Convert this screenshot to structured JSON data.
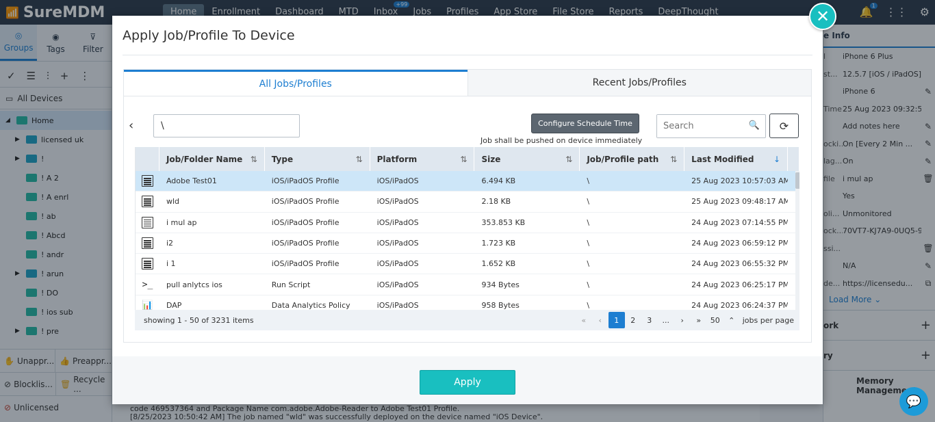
{
  "app": {
    "logo_text": "SureMDM",
    "nav": [
      {
        "label": "Home"
      },
      {
        "label": "Enrollment"
      },
      {
        "label": "Dashboard"
      },
      {
        "label": "MTD"
      },
      {
        "label": "Inbox",
        "badge": "+99"
      },
      {
        "label": "Jobs"
      },
      {
        "label": "Profiles"
      },
      {
        "label": "App Store"
      },
      {
        "label": "File Store"
      },
      {
        "label": "Reports"
      },
      {
        "label": "DeepThought"
      }
    ],
    "bell_badge": "1"
  },
  "left_panel": {
    "tabs": [
      {
        "label": "Groups"
      },
      {
        "label": "Tags"
      },
      {
        "label": "Filter"
      }
    ],
    "all_devices": "All Devices",
    "tree": [
      {
        "label": "Home",
        "expanded": true
      },
      {
        "label": "licensed uk",
        "arrow": true
      },
      {
        "label": "!",
        "arrow": true
      },
      {
        "label": "! A 2"
      },
      {
        "label": "! A enrl"
      },
      {
        "label": "! ab"
      },
      {
        "label": "! Abcd"
      },
      {
        "label": "! andr"
      },
      {
        "label": "! arun",
        "arrow": true
      },
      {
        "label": "! DO"
      },
      {
        "label": "! ios sub"
      },
      {
        "label": "! pre",
        "arrow": true
      }
    ],
    "bottom": [
      [
        "Unappr...",
        "Preappr..."
      ],
      [
        "Blocklis...",
        "Recycle ..."
      ],
      [
        "Unlicensed"
      ]
    ]
  },
  "right_panel": {
    "header": "e Info",
    "rows": [
      {
        "k": "l",
        "v": "iPhone 6 Plus"
      },
      {
        "k": "st...",
        "v": "12.5.7 [iOS / iPadOS]"
      },
      {
        "k": "",
        "v": "iPhone 6",
        "action": "edit"
      },
      {
        "k": "Time",
        "v": "25 Aug 2023 09:32:50 A..."
      },
      {
        "k": "",
        "v": "Add notes here",
        "action": "edit"
      },
      {
        "k": "ocki...",
        "v": "On [Every 2 Min ...",
        "action": "edit"
      },
      {
        "k": "lag...",
        "v": "On",
        "action": "edit"
      },
      {
        "k": "file",
        "v": "i mul ap",
        "action": "delete"
      },
      {
        "k": "",
        "v": "Yes"
      },
      {
        "k": "oli...",
        "v": "Unmonitored"
      },
      {
        "k": "ock...",
        "v": "70VT7-KJ7A9-0UQ5-9X..."
      },
      {
        "k": "ssi...",
        "v": "",
        "action": "delete"
      },
      {
        "k": "",
        "v": "N/A",
        "action": "edit"
      },
      {
        "k": "de...",
        "v": "https://licensedu...",
        "action": "copy"
      }
    ],
    "load_more": "Load More",
    "sections": [
      "ork",
      "ry",
      "Memory Management"
    ]
  },
  "log": {
    "line1": "code 469537364 and Package Name com.adobe.Adobe-Reader to Adobe Test01 Profile.",
    "line2": "[8/25/2023 10:50:42 AM] The job named \"wld\" was successfully deployed on the device named \"iOS Device\"."
  },
  "modal": {
    "title": "Apply Job/Profile To Device",
    "tabs": [
      {
        "label": "All Jobs/Profiles",
        "active": true
      },
      {
        "label": "Recent Jobs/Profiles",
        "active": false
      }
    ],
    "path_value": "\\",
    "schedule_button": "Configure Schedule Time",
    "schedule_note": "Job shall be pushed on device immediately",
    "search_placeholder": "Search",
    "columns": [
      "Job/Folder Name",
      "Type",
      "Platform",
      "Size",
      "Job/Profile path",
      "Last Modified"
    ],
    "rows": [
      {
        "icon": "profile-icon",
        "name": "Adobe Test01",
        "type": "iOS/iPadOS Profile",
        "platform": "iOS/iPadOS",
        "size": "6.494 KB",
        "path": "\\",
        "modified": "25 Aug 2023 10:57:03 AM",
        "selected": true
      },
      {
        "icon": "profile-icon",
        "name": "wld",
        "type": "iOS/iPadOS Profile",
        "platform": "iOS/iPadOS",
        "size": "2.18 KB",
        "path": "\\",
        "modified": "25 Aug 2023 09:48:17 AM"
      },
      {
        "icon": "profile-icon",
        "name": "i mul ap",
        "type": "iOS/iPadOS Profile",
        "platform": "iOS/iPadOS",
        "size": "353.853 KB",
        "path": "\\",
        "modified": "24 Aug 2023 07:14:55 PM"
      },
      {
        "icon": "profile-icon",
        "name": "i2",
        "type": "iOS/iPadOS Profile",
        "platform": "iOS/iPadOS",
        "size": "1.723 KB",
        "path": "\\",
        "modified": "24 Aug 2023 06:59:12 PM"
      },
      {
        "icon": "profile-icon",
        "name": "i 1",
        "type": "iOS/iPadOS Profile",
        "platform": "iOS/iPadOS",
        "size": "1.652 KB",
        "path": "\\",
        "modified": "24 Aug 2023 06:55:32 PM"
      },
      {
        "icon": "script-icon",
        "name": "pull anlytcs ios",
        "type": "Run Script",
        "platform": "iOS/iPadOS",
        "size": "934 Bytes",
        "path": "\\",
        "modified": "24 Aug 2023 06:25:17 PM"
      },
      {
        "icon": "analytics-icon",
        "name": "DAP",
        "type": "Data Analytics Policy",
        "platform": "iOS/iPadOS",
        "size": "958 Bytes",
        "path": "\\",
        "modified": "24 Aug 2023 06:24:37 PM"
      }
    ],
    "showing": "showing 1 - 50 of 3231 items",
    "pages": [
      "1",
      "2",
      "3",
      "..."
    ],
    "current_page": "1",
    "per_page": "50",
    "per_page_label": "jobs per page",
    "apply_label": "Apply"
  }
}
